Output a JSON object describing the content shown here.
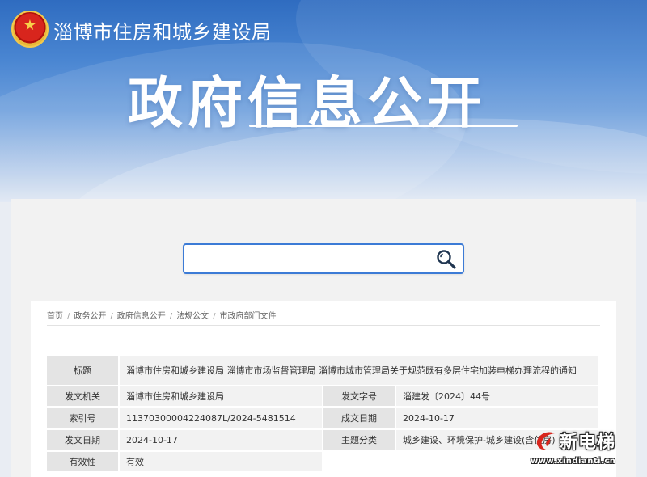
{
  "header": {
    "agency": "淄博市住房和城乡建设局",
    "title": "政府信息公开"
  },
  "search": {
    "value": "",
    "placeholder": ""
  },
  "breadcrumb": [
    "首页",
    "政务公开",
    "政府信息公开",
    "法规公文",
    "市政府部门文件"
  ],
  "info": {
    "title_label": "标题",
    "title_value": "淄博市住房和城乡建设局 淄博市市场监督管理局 淄博市城市管理局关于规范既有多层住宅加装电梯办理流程的通知",
    "issuer_label": "发文机关",
    "issuer_value": "淄博市住房和城乡建设局",
    "docno_label": "发文字号",
    "docno_value": "淄建发〔2024〕44号",
    "index_label": "索引号",
    "index_value": "11370300004224087L/2024-5481514",
    "created_label": "成文日期",
    "created_value": "2024-10-17",
    "issued_label": "发文日期",
    "issued_value": "2024-10-17",
    "category_label": "主题分类",
    "category_value": "城乡建设、环境保护-城乡建设(含住房)",
    "validity_label": "有效性",
    "validity_value": "有效"
  },
  "watermark": {
    "name": "新电梯",
    "url": "www.xindianti.cn"
  },
  "colors": {
    "accent": "#3c7bd6",
    "label_bg": "#e4e4e4",
    "value_bg": "#f2f2f2"
  }
}
